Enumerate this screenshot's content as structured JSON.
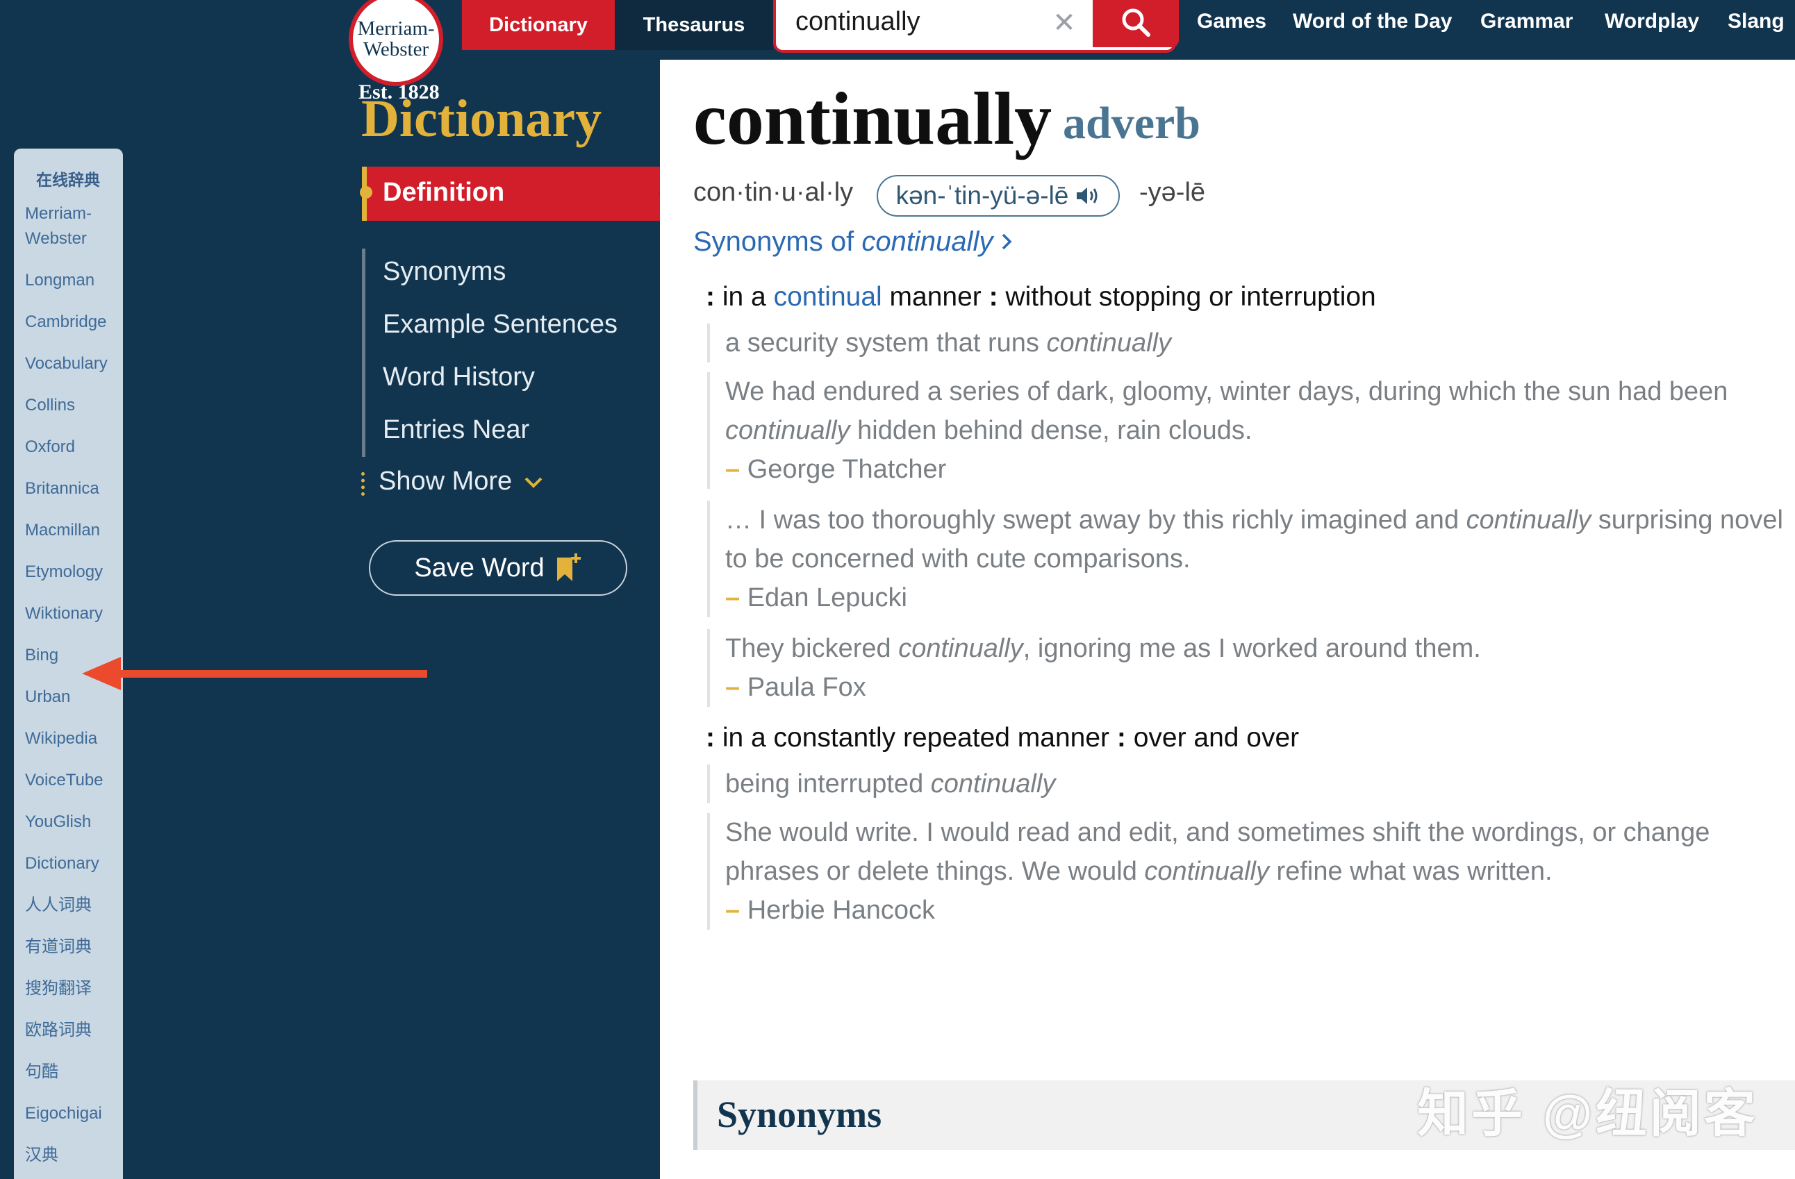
{
  "logo": {
    "line1": "Merriam-",
    "line2": "Webster",
    "est": "Est. 1828"
  },
  "tabs": {
    "dictionary": "Dictionary",
    "thesaurus": "Thesaurus"
  },
  "search": {
    "value": "continually"
  },
  "nav_links": [
    "Games",
    "Word of the Day",
    "Grammar",
    "Wordplay",
    "Slang"
  ],
  "dict_sidebar": {
    "heading": "在线辞典",
    "items": [
      "Merriam-Webster",
      "Longman",
      "Cambridge",
      "Vocabulary",
      "Collins",
      "Oxford",
      "Britannica",
      "Macmillan",
      "Etymology",
      "Wiktionary",
      "Bing",
      "Urban",
      "Wikipedia",
      "VoiceTube",
      "YouGlish",
      "Dictionary",
      "人人词典",
      "有道词典",
      "搜狗翻译",
      "欧路词典",
      "句酷",
      "Eigochigai",
      "汉典"
    ]
  },
  "page_nav": {
    "title": "Dictionary",
    "active": "Definition",
    "items": [
      "Synonyms",
      "Example Sentences",
      "Word History",
      "Entries Near"
    ],
    "show_more": "Show More",
    "save_word": "Save Word"
  },
  "entry": {
    "headword": "continually",
    "pos": "adverb",
    "syllables": "con·tin·u·al·ly",
    "pronunciation": "kən-ˈtin-yü-ə-lē",
    "alt_pronunciation": "-yə-lē",
    "synonyms_link_prefix": "Synonyms of ",
    "synonyms_link_word": "continually",
    "senses": [
      {
        "colon": ":",
        "pre": " in a ",
        "link": "continual",
        "post": " manner ",
        "colon2": ":",
        "tail": " without stopping or interruption"
      },
      {
        "colon": ":",
        "text": " in a constantly repeated manner ",
        "colon2": ":",
        "tail": " over and over"
      }
    ],
    "examples": [
      {
        "pre": "a security system that runs ",
        "em": "continually",
        "post": ""
      },
      {
        "pre": "We had endured a series of dark, gloomy, winter days, during which the sun had been ",
        "em": "continually",
        "post": " hidden behind dense, rain clouds.",
        "author": "George Thatcher"
      },
      {
        "pre": "… I was too thoroughly swept away by this richly imagined and ",
        "em": "continually",
        "post": " surprising novel to be concerned with cute comparisons.",
        "author": "Edan Lepucki"
      },
      {
        "pre": "They bickered ",
        "em": "continually",
        "post": ", ignoring me as I worked around them.",
        "author": "Paula Fox"
      },
      {
        "pre": "being interrupted ",
        "em": "continually",
        "post": ""
      },
      {
        "pre": "She would write. I would read and edit, and sometimes shift the wordings, or change phrases or delete things. We would ",
        "em": "continually",
        "post": " refine what was written.",
        "author": "Herbie Hancock"
      }
    ],
    "attribution_dash": "–",
    "synonyms_heading": "Synonyms"
  },
  "watermark": "知乎 @纽阅客",
  "colors": {
    "brand_blue": "#12354f",
    "brand_red": "#d11e2a",
    "gold": "#e2b23a",
    "link": "#2a69b3",
    "arrow": "#ec4a2d"
  }
}
